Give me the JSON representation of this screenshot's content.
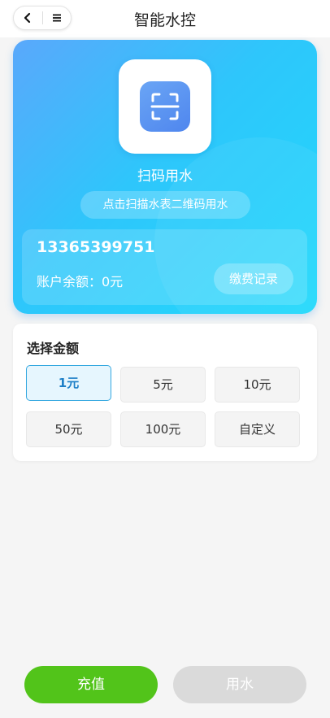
{
  "header": {
    "title": "智能水控",
    "back_icon": "chevron-left-icon",
    "menu_icon": "menu-icon"
  },
  "scan": {
    "icon": "scan-qr-icon",
    "label": "扫码用水",
    "hint": "点击扫描水表二维码用水"
  },
  "account": {
    "phone": "13365399751",
    "balance": "账户余额：0元",
    "record_button": "缴费记录"
  },
  "amount": {
    "title": "选择金额",
    "options": [
      {
        "label": "1元",
        "selected": true
      },
      {
        "label": "5元",
        "selected": false
      },
      {
        "label": "10元",
        "selected": false
      },
      {
        "label": "50元",
        "selected": false
      },
      {
        "label": "100元",
        "selected": false
      },
      {
        "label": "自定义",
        "selected": false
      }
    ]
  },
  "actions": {
    "recharge": "充值",
    "use_water": "用水",
    "use_water_enabled": false
  },
  "colors": {
    "accent_green": "#52c41a",
    "hero_gradient_start": "#5aa8fb",
    "hero_gradient_end": "#21d9fb",
    "selected_border": "#35a8e0"
  }
}
